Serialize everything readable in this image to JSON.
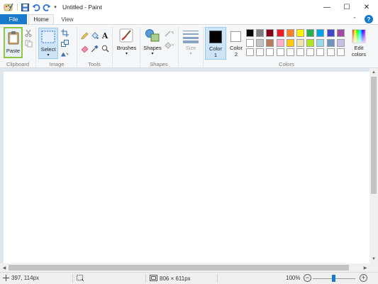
{
  "window": {
    "title": "Untitled - Paint",
    "minimize_glyph": "—",
    "maximize_glyph": "☐",
    "close_glyph": "✕",
    "quick_access_more_glyph": "▾"
  },
  "tabs": {
    "file": "File",
    "home": "Home",
    "view": "View",
    "minimize_glyph": "⌃",
    "help_glyph": "?"
  },
  "ribbon": {
    "clipboard": {
      "paste": "Paste",
      "group": "Clipboard"
    },
    "image": {
      "select": "Select",
      "group": "Image"
    },
    "tools": {
      "group": "Tools",
      "text_tool_glyph": "A"
    },
    "brushes": {
      "label": "Brushes"
    },
    "shapes": {
      "label": "Shapes",
      "group": "Shapes"
    },
    "size": {
      "label": "Size"
    },
    "colors": {
      "color1_line1": "Color",
      "color1_line2": "1",
      "color2_line1": "Color",
      "color2_line2": "2",
      "edit_line1": "Edit",
      "edit_line2": "colors",
      "group": "Colors",
      "color1_value": "#000000",
      "color2_value": "#ffffff",
      "palette_row1": [
        "#000000",
        "#7f7f7f",
        "#880015",
        "#ed1c24",
        "#ff7f27",
        "#fff200",
        "#22b14c",
        "#00a2e8",
        "#3f48cc",
        "#a349a4"
      ],
      "palette_row2": [
        "#ffffff",
        "#c3c3c3",
        "#b97a57",
        "#ffaec9",
        "#ffc90e",
        "#efe4b0",
        "#b5e61d",
        "#99d9ea",
        "#7092be",
        "#c8bfe7"
      ],
      "palette_row3": [
        "#ffffff",
        "#ffffff",
        "#ffffff",
        "#ffffff",
        "#ffffff",
        "#ffffff",
        "#ffffff",
        "#ffffff",
        "#ffffff",
        "#ffffff"
      ]
    }
  },
  "status": {
    "cursor_position": "397, 114px",
    "image_size": "806 × 611px",
    "zoom": "100%"
  }
}
